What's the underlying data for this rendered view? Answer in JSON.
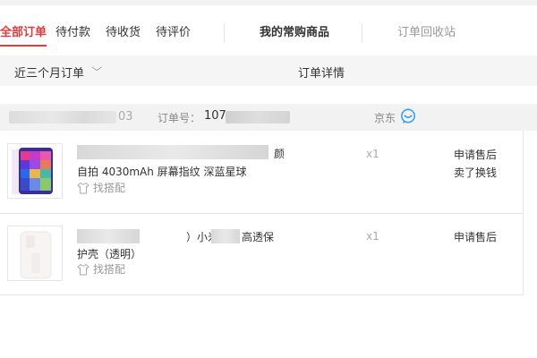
{
  "tabs": {
    "all_orders": "全部订单",
    "to_pay": "待付款",
    "to_receive": "待收货",
    "to_review": "待评价",
    "frequent": "我的常购商品",
    "recycle_bin": "订单回收站"
  },
  "filter": {
    "time_range": "近三个月订单",
    "details_header": "订单详情"
  },
  "order": {
    "date_tail": "03",
    "number_label": "订单号：",
    "number_prefix": "107",
    "shop": "京东",
    "items": [
      {
        "title_fragment_line1": "颜",
        "title_line2": "自拍 4030mAh 屏幕指纹 深蓝星球",
        "pair_label": "找搭配",
        "quantity": "x1",
        "actions": [
          "申请售后",
          "卖了换钱"
        ]
      },
      {
        "title_fragment_line1a": "",
        "title_fragment_line1b": "）小米",
        "title_fragment_line1c": "高透保",
        "title_line2": "护壳（透明）",
        "pair_label": "找搭配",
        "quantity": "x1",
        "actions": [
          "申请售后"
        ]
      }
    ]
  },
  "colors": {
    "accent": "#e4393c",
    "chat_icon": "#3aa0e8"
  }
}
